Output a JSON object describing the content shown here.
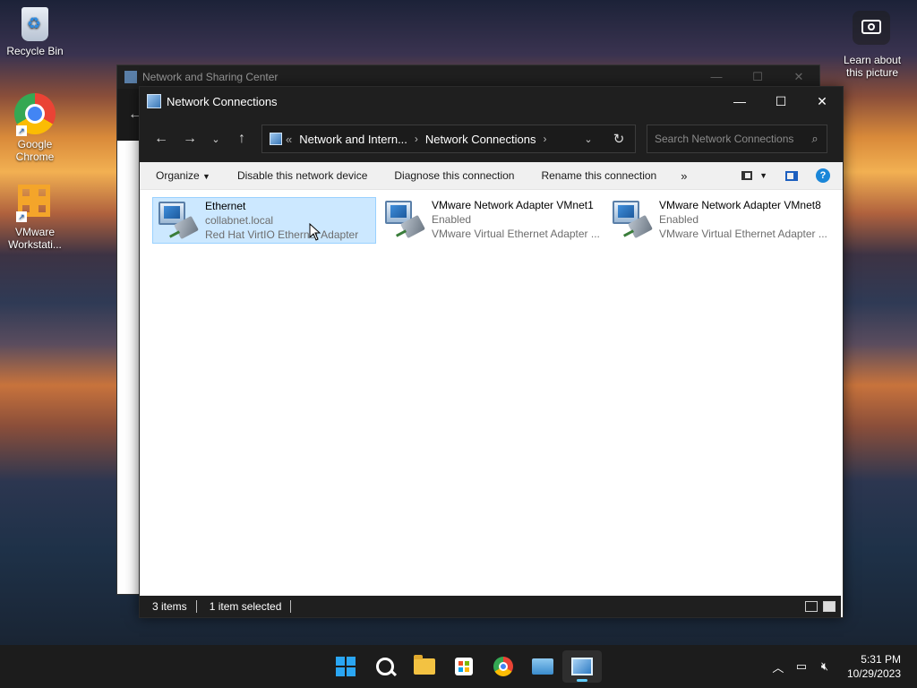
{
  "desktop": {
    "icons": [
      {
        "label": "Recycle Bin"
      },
      {
        "label": "Google Chrome"
      },
      {
        "label": "VMware Workstati..."
      }
    ],
    "spotlight": {
      "label": "Learn about this picture"
    }
  },
  "background_window": {
    "title": "Network and Sharing Center"
  },
  "window": {
    "title": "Network Connections",
    "address": {
      "prefix": "«",
      "crumbs": [
        "Network and Intern...",
        "Network Connections"
      ]
    },
    "search_placeholder": "Search Network Connections",
    "commands": {
      "organize": "Organize",
      "disable": "Disable this network device",
      "diagnose": "Diagnose this connection",
      "rename": "Rename this connection",
      "more": "»"
    },
    "items": [
      {
        "name": "Ethernet",
        "status": "collabnet.local",
        "device": "Red Hat VirtIO Ethernet Adapter",
        "selected": true
      },
      {
        "name": "VMware Network Adapter VMnet1",
        "status": "Enabled",
        "device": "VMware Virtual Ethernet Adapter ...",
        "selected": false
      },
      {
        "name": "VMware Network Adapter VMnet8",
        "status": "Enabled",
        "device": "VMware Virtual Ethernet Adapter ...",
        "selected": false
      }
    ],
    "status": {
      "count": "3 items",
      "selection": "1 item selected"
    }
  },
  "taskbar": {
    "apps": [
      "start-icon",
      "search-icon",
      "file-explorer-icon",
      "microsoft-store-icon",
      "chrome-icon",
      "keyboard-app-icon",
      "network-connections-icon"
    ],
    "clock": {
      "time": "5:31 PM",
      "date": "10/29/2023"
    }
  },
  "colors": {
    "accent": "#0078d4",
    "selection": "#cce8ff",
    "titlebar": "#1f1f1f"
  }
}
